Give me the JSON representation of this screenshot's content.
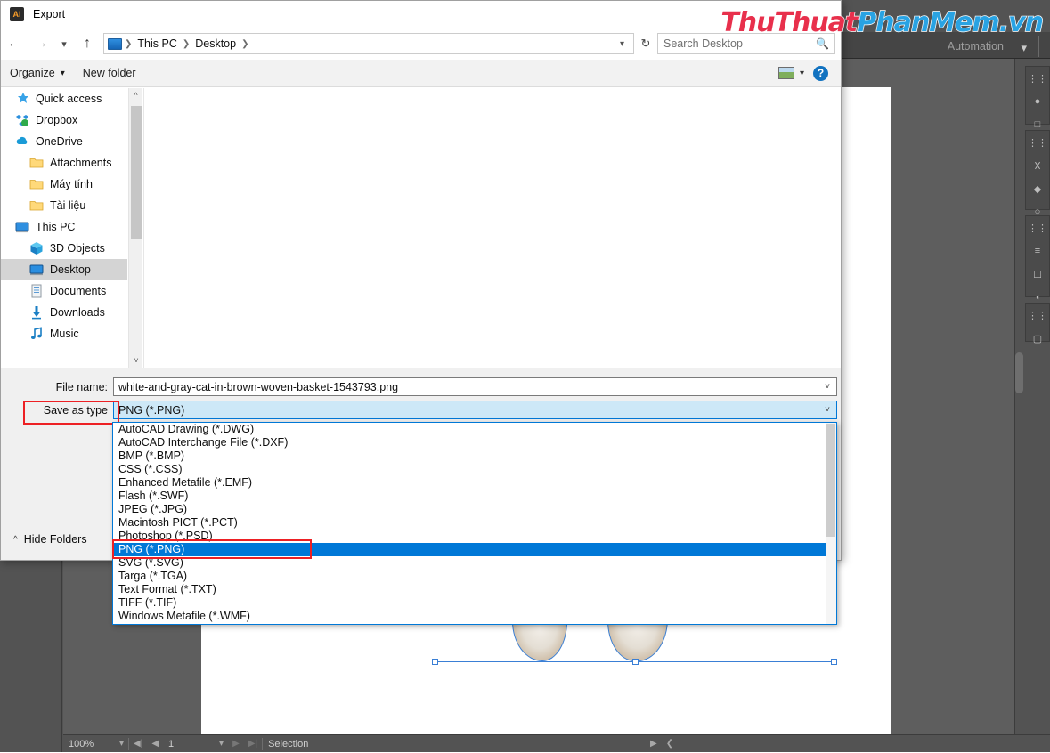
{
  "app": {
    "automation_label": "Automation",
    "statusbar": {
      "zoom": "100%",
      "page": "1",
      "status": "Selection"
    }
  },
  "dialog": {
    "title": "Export",
    "app_badge": "Ai",
    "nav": {
      "back_icon": "back-arrow-icon",
      "forward_icon": "forward-arrow-icon",
      "recent_icon": "chevron-down-icon",
      "up_icon": "up-arrow-icon",
      "breadcrumbs": [
        "This PC",
        "Desktop"
      ],
      "refresh_icon": "refresh-icon"
    },
    "search": {
      "placeholder": "Search Desktop",
      "icon": "search-icon"
    },
    "toolbar": {
      "organize": "Organize",
      "organize_caret": "▾",
      "new_folder": "New folder",
      "view_icon": "view-layout-icon",
      "view_caret": "▾",
      "help": "?"
    },
    "sidebar": [
      {
        "label": "Quick access",
        "icon": "pin-star-icon",
        "indent": false,
        "selected": false
      },
      {
        "label": "Dropbox",
        "icon": "dropbox-icon",
        "indent": false,
        "selected": false
      },
      {
        "label": "OneDrive",
        "icon": "cloud-icon",
        "indent": false,
        "selected": false
      },
      {
        "label": "Attachments",
        "icon": "folder-icon",
        "indent": true,
        "selected": false
      },
      {
        "label": "Máy tính",
        "icon": "folder-icon",
        "indent": true,
        "selected": false
      },
      {
        "label": "Tài liệu",
        "icon": "folder-icon",
        "indent": true,
        "selected": false
      },
      {
        "label": "This PC",
        "icon": "computer-icon",
        "indent": false,
        "selected": false
      },
      {
        "label": "3D Objects",
        "icon": "cube-icon",
        "indent": true,
        "selected": false
      },
      {
        "label": "Desktop",
        "icon": "desktop-icon",
        "indent": true,
        "selected": true
      },
      {
        "label": "Documents",
        "icon": "document-icon",
        "indent": true,
        "selected": false
      },
      {
        "label": "Downloads",
        "icon": "download-icon",
        "indent": true,
        "selected": false
      },
      {
        "label": "Music",
        "icon": "music-icon",
        "indent": true,
        "selected": false
      }
    ],
    "fields": {
      "filename_label": "File name:",
      "filename_value": "white-and-gray-cat-in-brown-woven-basket-1543793.png",
      "savetype_label": "Save as type",
      "savetype_value": "PNG (*.PNG)",
      "caret": "⌄"
    },
    "dropdown_options": [
      "AutoCAD Drawing (*.DWG)",
      "AutoCAD Interchange File (*.DXF)",
      "BMP (*.BMP)",
      "CSS (*.CSS)",
      "Enhanced Metafile (*.EMF)",
      "Flash (*.SWF)",
      "JPEG (*.JPG)",
      "Macintosh PICT (*.PCT)",
      "Photoshop (*.PSD)",
      "PNG (*.PNG)",
      "SVG (*.SVG)",
      "Targa (*.TGA)",
      "Text Format (*.TXT)",
      "TIFF (*.TIF)",
      "Windows Metafile (*.WMF)"
    ],
    "dropdown_selected_index": 9,
    "hide_folders": {
      "label": "Hide Folders",
      "caret": "⌃"
    }
  },
  "watermark": {
    "part1": "ThuThuat",
    "part2": "PhanMem",
    "part3": ".vn"
  },
  "colors": {
    "accent_blue": "#0078d7",
    "highlight_red": "#ed2024",
    "selection_blue": "#3a7fd5",
    "ai_orange": "#f79d2a",
    "panel_gray": "#535353"
  }
}
